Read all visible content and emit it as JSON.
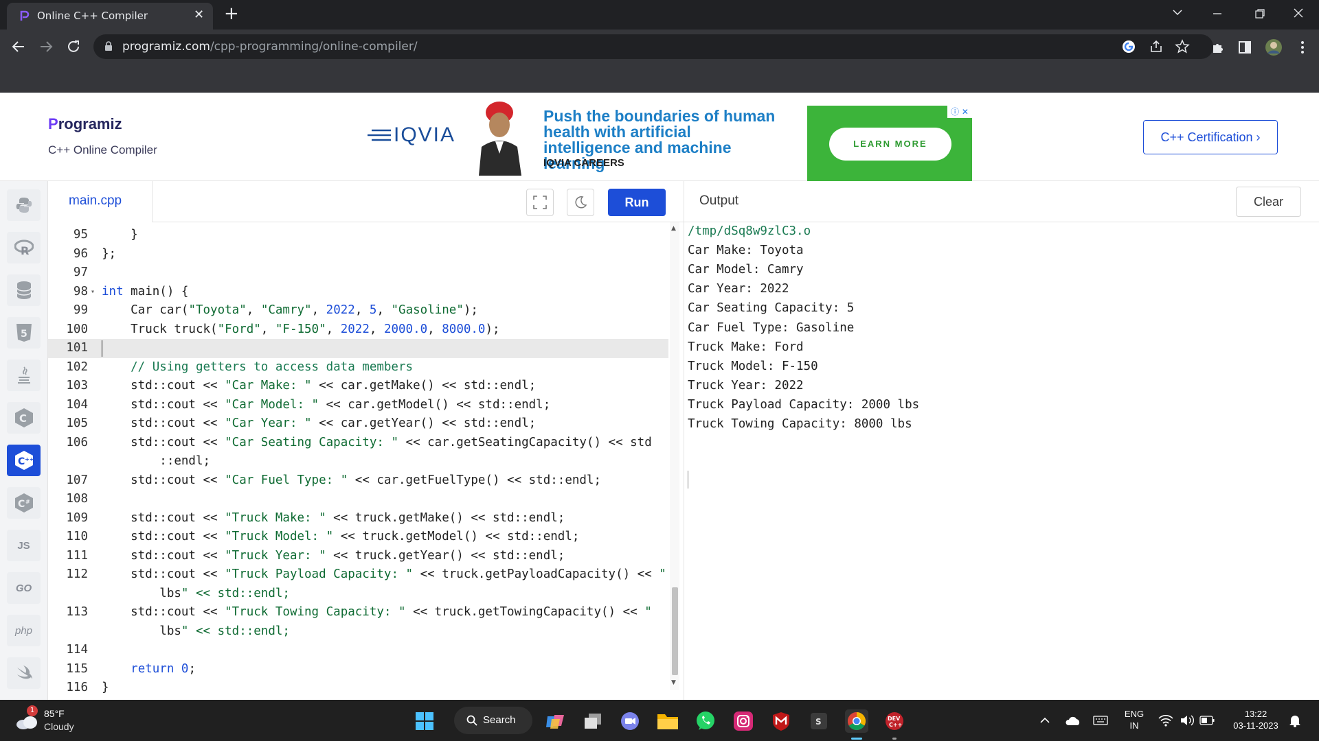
{
  "browser": {
    "tab_title": "Online C++ Compiler",
    "tab_close": "✕",
    "new_tab": "+",
    "url_host": "programiz.com",
    "url_path": "/cpp-programming/online-compiler/",
    "window_controls": [
      "chevron-down",
      "minimize",
      "restore",
      "close"
    ]
  },
  "site": {
    "logo_text": "rogramiz",
    "logo_initial": "P",
    "subtitle": "C++ Online Compiler",
    "certification_button": "C++ Certification ›",
    "ad": {
      "brand": "IQVIA",
      "headline": "Push the boundaries of human health with artificial intelligence and machine learning",
      "careers": "IQVIA CAREERS",
      "cta": "LEARN MORE"
    }
  },
  "sidebar": {
    "items": [
      {
        "name": "python",
        "label": ""
      },
      {
        "name": "r",
        "label": ""
      },
      {
        "name": "sql",
        "label": ""
      },
      {
        "name": "html",
        "label": ""
      },
      {
        "name": "java",
        "label": ""
      },
      {
        "name": "c",
        "label": ""
      },
      {
        "name": "cpp",
        "label": "",
        "active": true
      },
      {
        "name": "csharp",
        "label": ""
      },
      {
        "name": "js",
        "label": "JS"
      },
      {
        "name": "go",
        "label": "GO"
      },
      {
        "name": "php",
        "label": "php"
      },
      {
        "name": "swift",
        "label": ""
      }
    ]
  },
  "editor": {
    "file_name": "main.cpp",
    "run_label": "Run",
    "current_line": "101",
    "lines": [
      {
        "n": "95",
        "text": "    }"
      },
      {
        "n": "96",
        "text": "};"
      },
      {
        "n": "97",
        "text": ""
      },
      {
        "n": "98",
        "text": "int main() {",
        "fold": true
      },
      {
        "n": "99",
        "text": "    Car car(\"Toyota\", \"Camry\", 2022, 5, \"Gasoline\");"
      },
      {
        "n": "100",
        "text": "    Truck truck(\"Ford\", \"F-150\", 2022, 2000.0, 8000.0);"
      },
      {
        "n": "101",
        "text": ""
      },
      {
        "n": "102",
        "text": "    // Using getters to access data members"
      },
      {
        "n": "103",
        "text": "    std::cout << \"Car Make: \" << car.getMake() << std::endl;"
      },
      {
        "n": "104",
        "text": "    std::cout << \"Car Model: \" << car.getModel() << std::endl;"
      },
      {
        "n": "105",
        "text": "    std::cout << \"Car Year: \" << car.getYear() << std::endl;"
      },
      {
        "n": "106",
        "text": "    std::cout << \"Car Seating Capacity: \" << car.getSeatingCapacity() << std"
      },
      {
        "n": "",
        "text": "        ::endl;"
      },
      {
        "n": "107",
        "text": "    std::cout << \"Car Fuel Type: \" << car.getFuelType() << std::endl;"
      },
      {
        "n": "108",
        "text": ""
      },
      {
        "n": "109",
        "text": "    std::cout << \"Truck Make: \" << truck.getMake() << std::endl;"
      },
      {
        "n": "110",
        "text": "    std::cout << \"Truck Model: \" << truck.getModel() << std::endl;"
      },
      {
        "n": "111",
        "text": "    std::cout << \"Truck Year: \" << truck.getYear() << std::endl;"
      },
      {
        "n": "112",
        "text": "    std::cout << \"Truck Payload Capacity: \" << truck.getPayloadCapacity() << \""
      },
      {
        "n": "",
        "text": "        lbs\" << std::endl;"
      },
      {
        "n": "113",
        "text": "    std::cout << \"Truck Towing Capacity: \" << truck.getTowingCapacity() << \""
      },
      {
        "n": "",
        "text": "        lbs\" << std::endl;"
      },
      {
        "n": "114",
        "text": ""
      },
      {
        "n": "115",
        "text": "    return 0;"
      },
      {
        "n": "116",
        "text": "}"
      }
    ]
  },
  "output": {
    "title": "Output",
    "clear_label": "Clear",
    "lines": [
      "/tmp/dSq8w9zlC3.o",
      "Car Make: Toyota",
      "Car Model: Camry",
      "Car Year: 2022",
      "Car Seating Capacity: 5",
      "Car Fuel Type: Gasoline",
      "Truck Make: Ford",
      "Truck Model: F-150",
      "Truck Year: 2022",
      "Truck Payload Capacity: 2000 lbs",
      "Truck Towing Capacity: 8000 lbs"
    ]
  },
  "taskbar": {
    "weather_temp": "85°F",
    "weather_cond": "Cloudy",
    "weather_badge": "1",
    "search_label": "Search",
    "lang_top": "ENG",
    "lang_bottom": "IN",
    "time": "13:22",
    "date": "03-11-2023",
    "pinned": [
      "windows-start",
      "search",
      "copilot",
      "task-view",
      "teams-meet",
      "file-explorer",
      "whatsapp",
      "instagram",
      "mcafee",
      "sublime",
      "chrome",
      "dev-cpp"
    ]
  },
  "colors": {
    "accent": "#1d4ed8",
    "chrome_dark": "#202124",
    "chrome_mid": "#35363a",
    "string": "#0f6b33",
    "comment": "#1a7a52",
    "number": "#1d4ed8"
  }
}
